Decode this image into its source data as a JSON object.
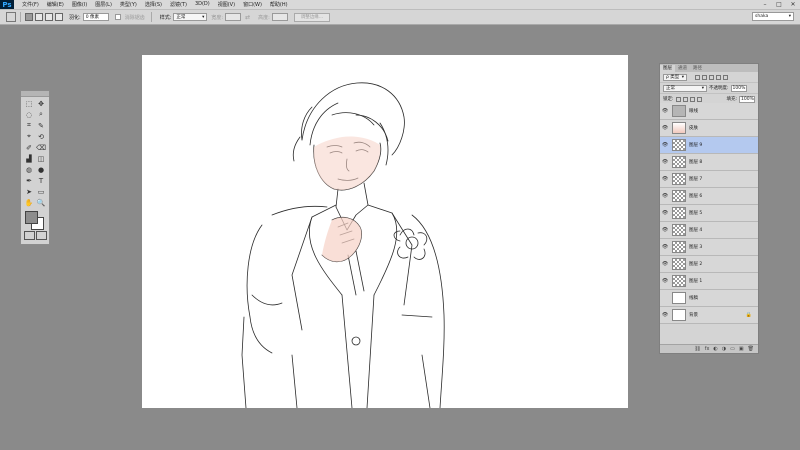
{
  "app": {
    "logo": "Ps",
    "menu": [
      "文件(F)",
      "编辑(E)",
      "图像(I)",
      "图层(L)",
      "类型(Y)",
      "选择(S)",
      "滤镜(T)",
      "3D(D)",
      "视图(V)",
      "窗口(W)",
      "帮助(H)"
    ],
    "window_controls": [
      "–",
      "□",
      "✕"
    ]
  },
  "options_bar": {
    "feather_label": "羽化:",
    "feather_value": "0 像素",
    "antialias_label": "消除锯齿",
    "style_label": "样式:",
    "style_value": "正常",
    "width_label": "宽度:",
    "height_label": "高度:",
    "refine_edge_label": "调整边缘...",
    "workspace": "shaka"
  },
  "toolbox": {
    "tools": [
      "⬚",
      "✥",
      "◌",
      "⌕",
      "⌗",
      "✎",
      "⌖",
      "⟲",
      "✐",
      "⌫",
      "▟",
      "◫",
      "◍",
      "●",
      "✒",
      "T",
      "➤",
      "▭",
      "✋",
      "🔍"
    ]
  },
  "layers_panel": {
    "tabs": [
      "图层",
      "通道",
      "路径"
    ],
    "filter_label": "ρ 类型",
    "blend_mode": "正常",
    "opacity_label": "不透明度:",
    "opacity_value": "100%",
    "lock_label": "锁定:",
    "fill_label": "填充:",
    "fill_value": "100%",
    "layers": [
      {
        "name": "眼线",
        "visible": true,
        "thumb": "gray"
      },
      {
        "name": "皮肤",
        "visible": true,
        "thumb": "skin"
      },
      {
        "name": "图层 9",
        "visible": true,
        "thumb": "checker",
        "selected": true
      },
      {
        "name": "图层 8",
        "visible": true,
        "thumb": "checker"
      },
      {
        "name": "图层 7",
        "visible": true,
        "thumb": "checker"
      },
      {
        "name": "图层 6",
        "visible": true,
        "thumb": "checker"
      },
      {
        "name": "图层 5",
        "visible": true,
        "thumb": "checker"
      },
      {
        "name": "图层 4",
        "visible": true,
        "thumb": "checker"
      },
      {
        "name": "图层 3",
        "visible": true,
        "thumb": "checker"
      },
      {
        "name": "图层 2",
        "visible": true,
        "thumb": "checker"
      },
      {
        "name": "图层 1",
        "visible": true,
        "thumb": "checker"
      },
      {
        "name": "线稿",
        "visible": false,
        "thumb": "plain"
      },
      {
        "name": "背景",
        "visible": true,
        "thumb": "plain",
        "locked": true
      }
    ],
    "footer_icons": [
      "⛓",
      "fx",
      "◐",
      "◑",
      "▭",
      "▣",
      "🗑"
    ]
  }
}
